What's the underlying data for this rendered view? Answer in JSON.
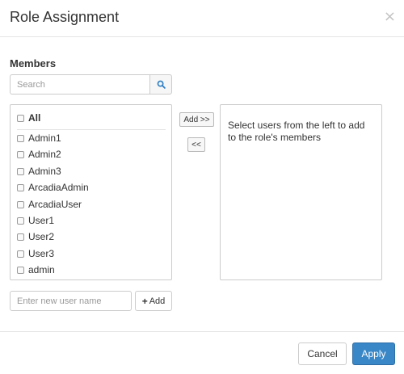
{
  "dialog": {
    "title": "Role Assignment",
    "close_glyph": "×"
  },
  "members": {
    "label": "Members",
    "search_placeholder": "Search",
    "search_icon": "search-icon",
    "users": [
      {
        "label": "All",
        "checked": false
      },
      {
        "label": "Admin1",
        "checked": false
      },
      {
        "label": "Admin2",
        "checked": false
      },
      {
        "label": "Admin3",
        "checked": false
      },
      {
        "label": "ArcadiaAdmin",
        "checked": false
      },
      {
        "label": "ArcadiaUser",
        "checked": false
      },
      {
        "label": "User1",
        "checked": false
      },
      {
        "label": "User2",
        "checked": false
      },
      {
        "label": "User3",
        "checked": false
      },
      {
        "label": "admin",
        "checked": false
      }
    ]
  },
  "transfer": {
    "add_label": "Add >>",
    "remove_label": "<<"
  },
  "role_members": {
    "hint": "Select users from the left to add to the role's members"
  },
  "new_user": {
    "placeholder": "Enter new user name",
    "add_label": "Add",
    "add_icon": "plus-icon"
  },
  "footer": {
    "cancel_label": "Cancel",
    "apply_label": "Apply"
  },
  "colors": {
    "accent": "#3a87c8",
    "search_icon": "#2f7fc4"
  }
}
